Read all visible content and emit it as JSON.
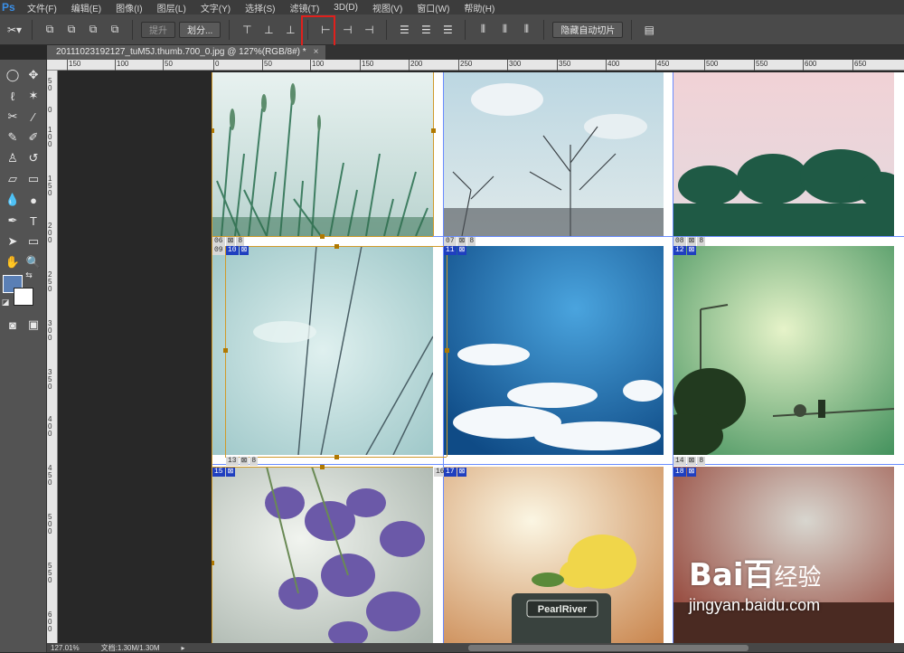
{
  "app": {
    "logo": "Ps"
  },
  "menu": [
    "文件(F)",
    "编辑(E)",
    "图像(I)",
    "图层(L)",
    "文字(Y)",
    "选择(S)",
    "滤镜(T)",
    "3D(D)",
    "视图(V)",
    "窗口(W)",
    "帮助(H)"
  ],
  "options": {
    "promote_label": "提升",
    "divide_label": "划分...",
    "hide_auto_slices_label": "隐藏自动切片"
  },
  "document": {
    "tab_title": "20111023192127_tuM5J.thumb.700_0.jpg @ 127%(RGB/8#) *",
    "close": "×"
  },
  "ruler": {
    "top_ticks": [
      "150",
      "100",
      "50",
      "0",
      "50",
      "100",
      "150",
      "200",
      "250",
      "300",
      "350",
      "400",
      "450",
      "500",
      "550",
      "600",
      "650"
    ],
    "left_ticks": [
      "5 0",
      "0",
      "1 0 0",
      "1 5 0",
      "2 0 0",
      "2 5 0",
      "3 0 0",
      "3 5 0",
      "4 0 0",
      "4 5 0",
      "5 0 0",
      "5 5 0",
      "6 0 0"
    ]
  },
  "slices": {
    "s06": {
      "num": "06",
      "icon": "⊠",
      "extra": "8"
    },
    "s07": {
      "num": "07",
      "icon": "⊠",
      "extra": "8"
    },
    "s08": {
      "num": "08",
      "icon": "⊠",
      "extra": "8"
    },
    "s09": {
      "num": "09"
    },
    "s10": {
      "num": "10",
      "icon": "⊠"
    },
    "s11": {
      "num": "11",
      "icon": "⊠"
    },
    "s12": {
      "num": "12",
      "icon": "⊠"
    },
    "s13": {
      "num": "13",
      "icon": "⊠",
      "extra": "8"
    },
    "s14": {
      "num": "14",
      "icon": "⊠",
      "extra": "8"
    },
    "s15": {
      "num": "15",
      "icon": "⊠"
    },
    "s16": {
      "num": "16"
    },
    "s17": {
      "num": "17",
      "icon": "⊠"
    },
    "s18": {
      "num": "18",
      "icon": "⊠"
    }
  },
  "photos": {
    "p5_sign": "PearlRiver"
  },
  "status": {
    "zoom": "127.01%",
    "doc_info": "文档:1.30M/1.30M"
  },
  "watermark": {
    "logo": "Bai",
    "logo_suffix": "百",
    "logo_cn": "经验",
    "url": "jingyan.baidu.com"
  }
}
